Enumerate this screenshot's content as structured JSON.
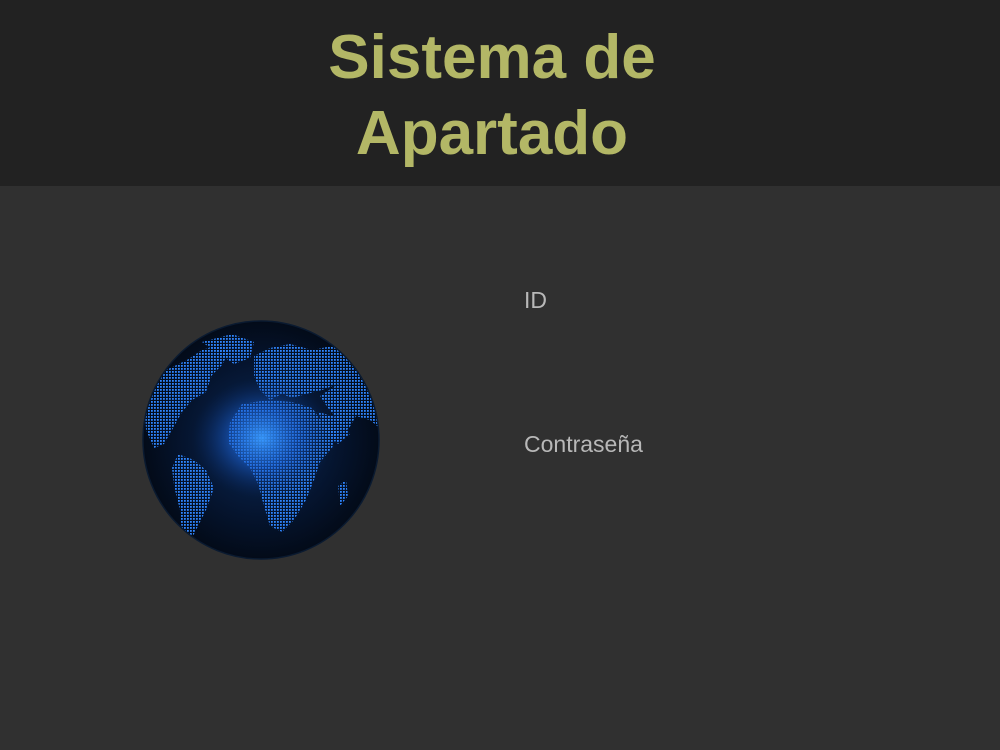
{
  "header": {
    "title_line1": "Sistema de",
    "title_line2": "Apartado",
    "title_color": "#b3b766",
    "background": "#222222"
  },
  "main": {
    "background": "#303030",
    "image": {
      "icon": "globe-icon",
      "description_color": "#1e6fe0"
    },
    "form": {
      "id_label": "ID",
      "id_value": "",
      "password_label": "Contraseña",
      "password_value": ""
    }
  }
}
